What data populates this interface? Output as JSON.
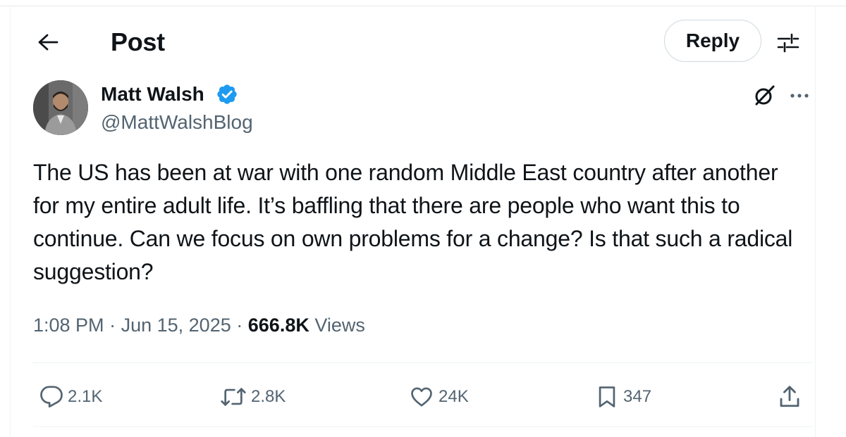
{
  "header": {
    "title": "Post",
    "reply_label": "Reply"
  },
  "icons": {
    "back": "arrow-left-icon",
    "settings": "sliders-icon",
    "verified": "verified-badge-icon",
    "grok": "grok-icon",
    "more": "more-horizontal-icon",
    "reply": "reply-icon",
    "repost": "repost-icon",
    "like": "heart-icon",
    "bookmark": "bookmark-icon",
    "share": "share-icon"
  },
  "colors": {
    "text": "#0f1419",
    "secondary": "#536471",
    "verified": "#1d9bf0",
    "border": "#cfd9de"
  },
  "post": {
    "author_name": "Matt Walsh",
    "handle": "@MattWalshBlog",
    "text": "The US has been at war with one random Middle East country after another for my entire adult life. It’s baffling that there are people who want this to continue. Can we focus on own problems for a change? Is that such a radical suggestion?",
    "time": "1:08 PM",
    "separator": "·",
    "date": "Jun 15, 2025",
    "views_count": "666.8K",
    "views_label": "Views"
  },
  "actions": {
    "replies": "2.1K",
    "reposts": "2.8K",
    "likes": "24K",
    "bookmarks": "347"
  }
}
